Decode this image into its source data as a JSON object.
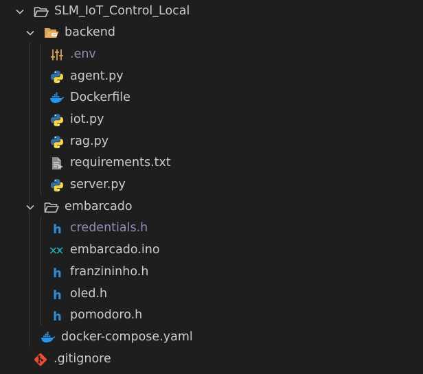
{
  "explorer": {
    "root": {
      "label": "SLM_IoT_Control_Local",
      "icon": "folder-open-icon",
      "expanded": true
    },
    "backend": {
      "label": "backend",
      "icon": "folder-open-backend-icon",
      "expanded": true,
      "files": [
        {
          "label": ".env",
          "icon": "env-settings-icon",
          "ignored": true
        },
        {
          "label": "agent.py",
          "icon": "python-icon"
        },
        {
          "label": "Dockerfile",
          "icon": "docker-icon"
        },
        {
          "label": "iot.py",
          "icon": "python-icon"
        },
        {
          "label": "rag.py",
          "icon": "python-icon"
        },
        {
          "label": "requirements.txt",
          "icon": "text-file-icon"
        },
        {
          "label": "server.py",
          "icon": "python-icon"
        }
      ]
    },
    "embarcado": {
      "label": "embarcado",
      "icon": "folder-open-icon",
      "expanded": true,
      "files": [
        {
          "label": "credentials.h",
          "icon": "c-header-icon",
          "ignored": true
        },
        {
          "label": "embarcado.ino",
          "icon": "arduino-icon"
        },
        {
          "label": "franzininho.h",
          "icon": "c-header-icon"
        },
        {
          "label": "oled.h",
          "icon": "c-header-icon"
        },
        {
          "label": "pomodoro.h",
          "icon": "c-header-icon"
        }
      ]
    },
    "docker_compose": {
      "label": "docker-compose.yaml",
      "icon": "docker-icon"
    },
    "gitignore": {
      "label": ".gitignore",
      "icon": "git-icon"
    }
  },
  "colors": {
    "background": "#1e1e1e",
    "text": "#cccccc",
    "ignored_text": "#8c8fb7",
    "folder": "#c5c5c5",
    "python_blue": "#3572A5",
    "python_yellow": "#f5d547",
    "docker": "#2496ed",
    "c_header": "#2a8fd6",
    "git": "#e84e31",
    "env": "#d7a35a"
  }
}
